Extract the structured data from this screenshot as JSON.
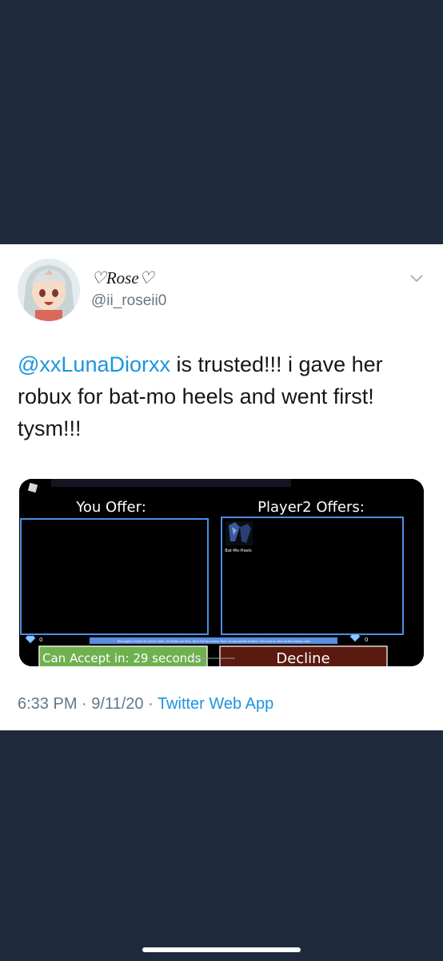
{
  "user": {
    "display_name": "♡Rose♡",
    "handle": "@ii_roseii0"
  },
  "tweet": {
    "mention": "@xxLunaDiorxx",
    "text": " is trusted!!! i gave her robux for bat-mo heels and went first! tysm!!!"
  },
  "media": {
    "you_offer_label": "You Offer:",
    "player2_offers_label": "Player2 Offers:",
    "item_name": "Bat-Mo-Heels",
    "your_diamonds": "0",
    "their_diamonds": "0",
    "notice_text": "Thoroughly review the entire trade. All trades are final, don't fall for scams! Don't accept partial trades! Click here to view all the trading rules",
    "accept_button_label": "Can Accept in: 29 seconds",
    "decline_button_label": "Decline"
  },
  "meta": {
    "time": "6:33 PM",
    "separator": " · ",
    "date": "9/11/20",
    "source": "Twitter Web App"
  },
  "colors": {
    "background": "#1f2a3d",
    "link": "#1b95e0",
    "accept_green": "#6fb04f",
    "decline_red": "#5a1a10",
    "panel_border": "#4d8fe0"
  }
}
